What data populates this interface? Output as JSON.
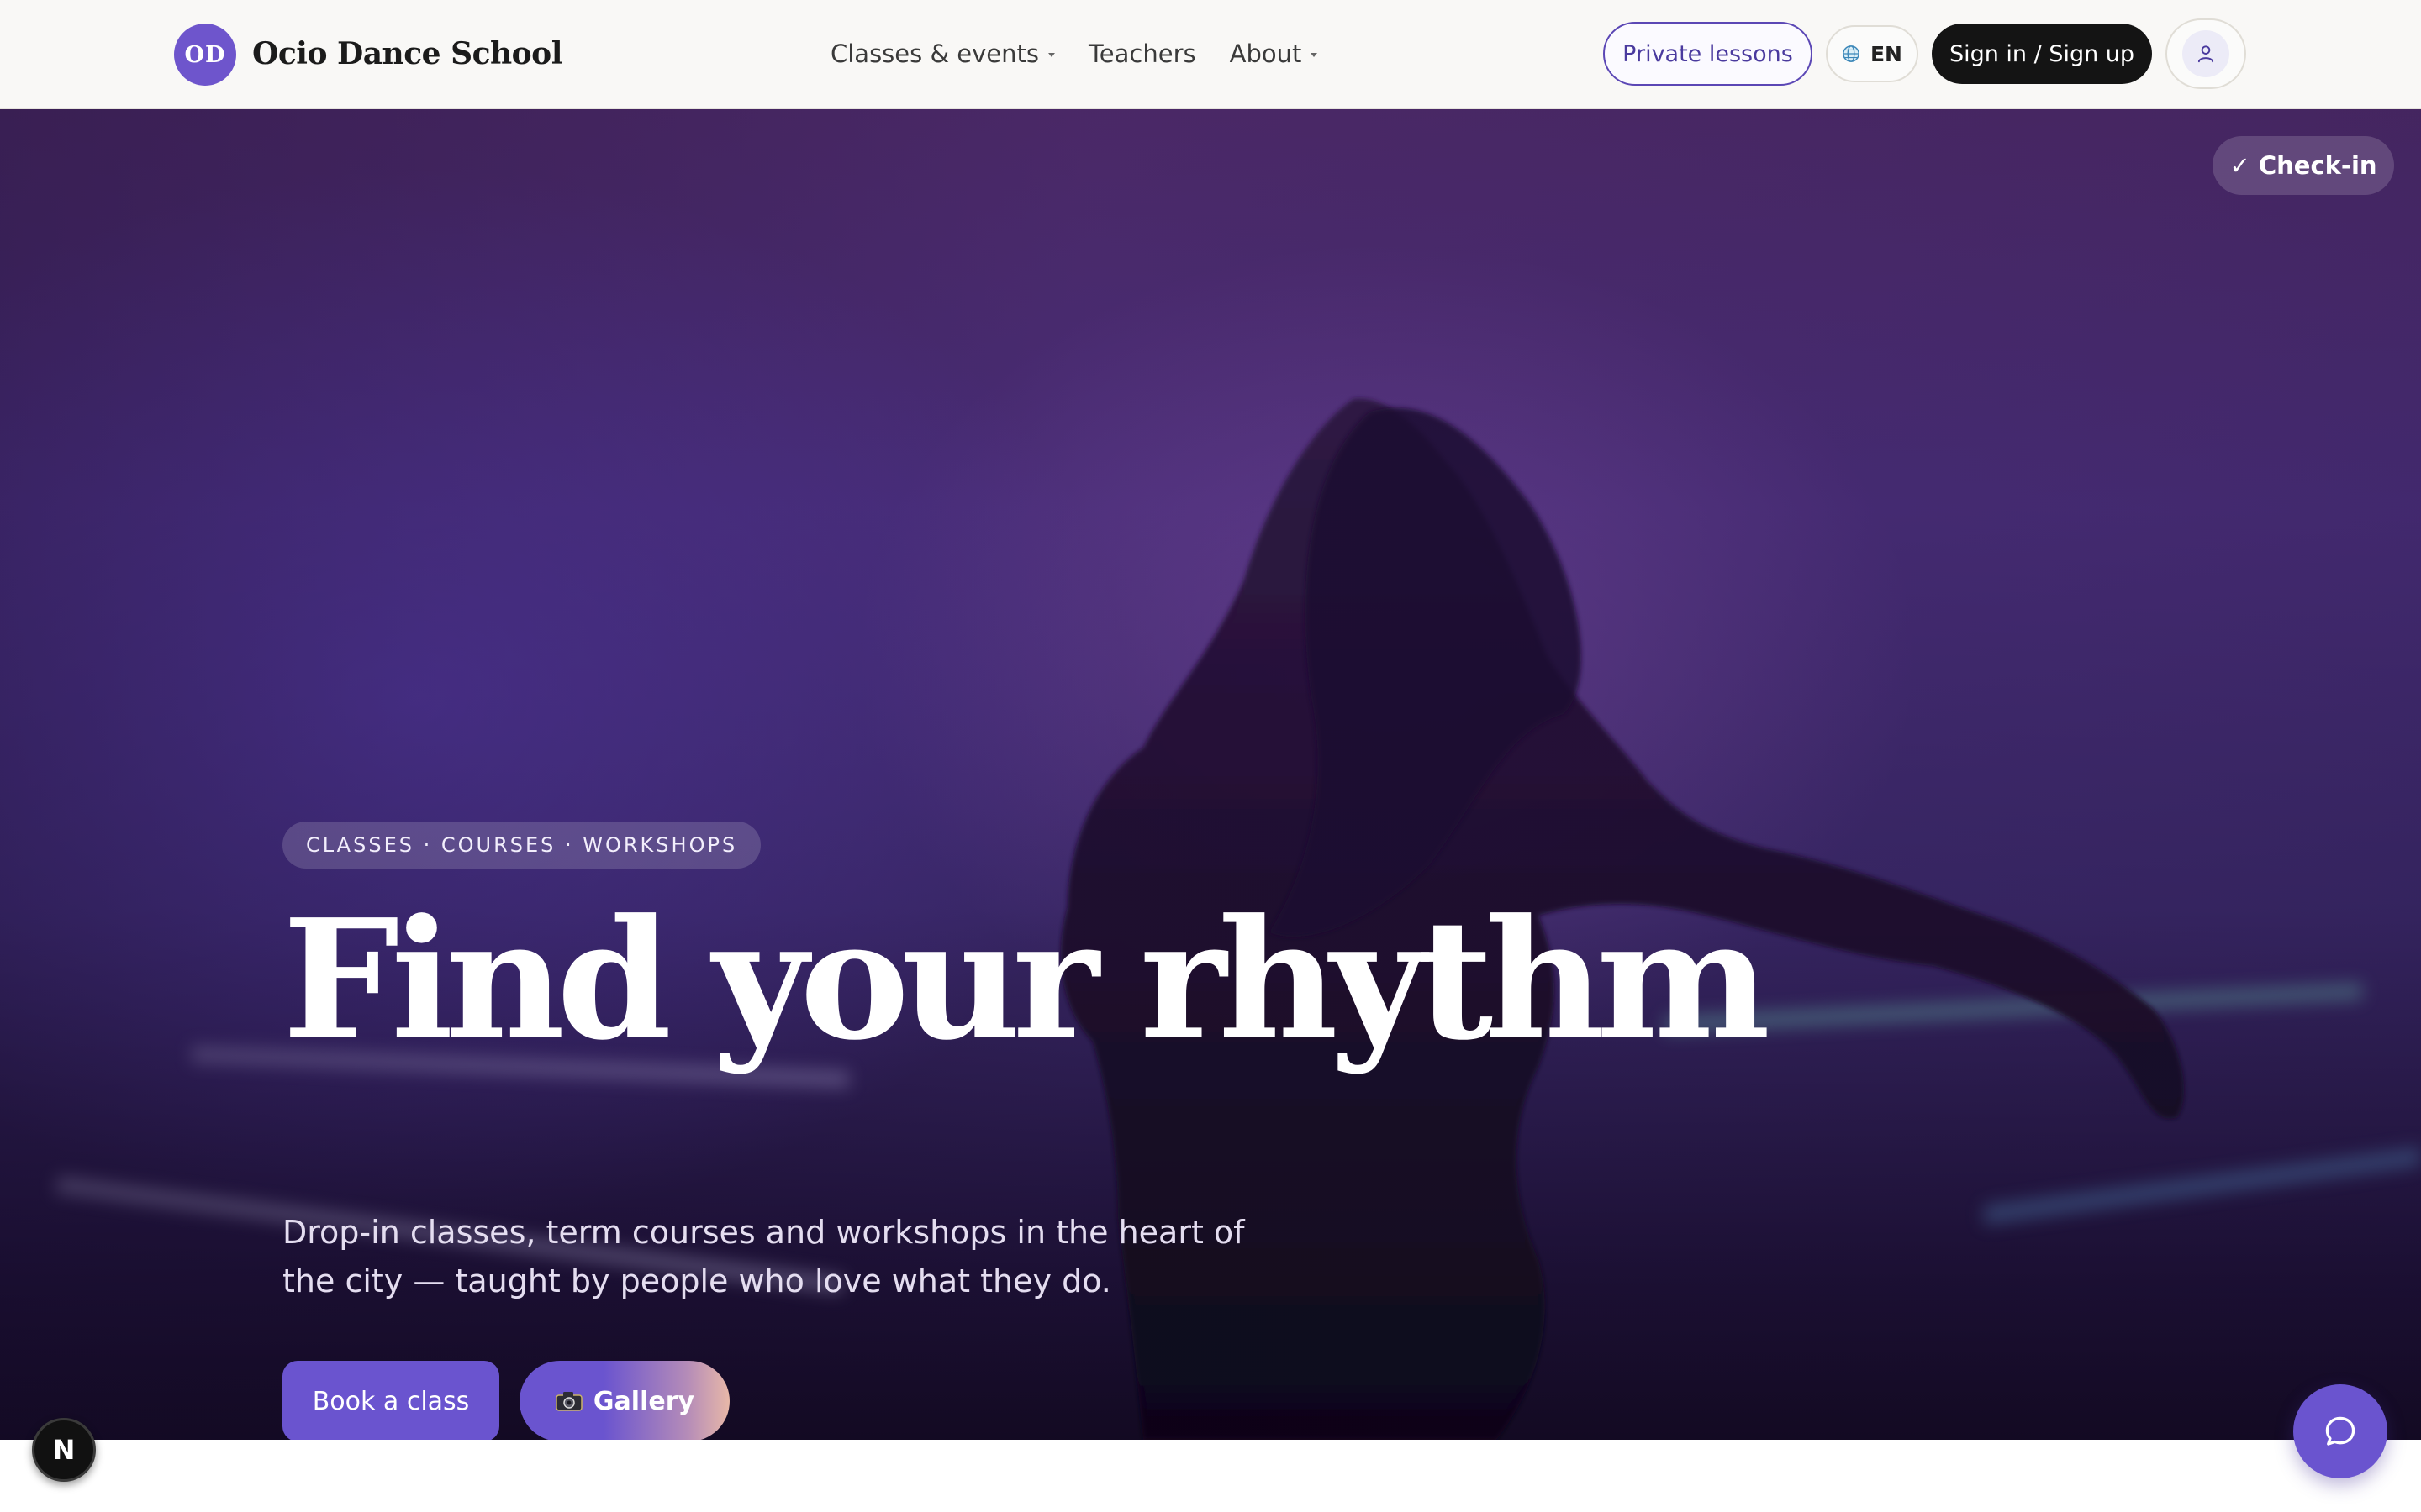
{
  "header": {
    "logo_initials": "OD",
    "brand_name": "Ocio Dance School",
    "nav": [
      {
        "label": "Classes & events",
        "has_dropdown": true
      },
      {
        "label": "Teachers",
        "has_dropdown": false
      },
      {
        "label": "About",
        "has_dropdown": true
      }
    ],
    "private_lessons_label": "Private lessons",
    "language_label": "EN",
    "signin_label": "Sign in / Sign up"
  },
  "hero": {
    "checkin_label": "✓ Check-in",
    "tagline": "CLASSES · COURSES · WORKSHOPS",
    "headline": "Find your rhythm",
    "subtitle": "Drop-in classes, term courses and workshops in the heart of the city — taught by people who love what they do.",
    "book_label": "Book a class",
    "gallery_label": "Gallery"
  },
  "floating": {
    "n_badge_label": "N"
  },
  "icons": {
    "globe": "globe-icon",
    "user": "user-icon",
    "camera": "camera-icon",
    "chat": "chat-bubble-icon"
  },
  "colors": {
    "brand": "#6a54cf",
    "dark_button": "#141414",
    "hero_top": "#4d2a6a",
    "hero_bottom": "#130a22"
  }
}
